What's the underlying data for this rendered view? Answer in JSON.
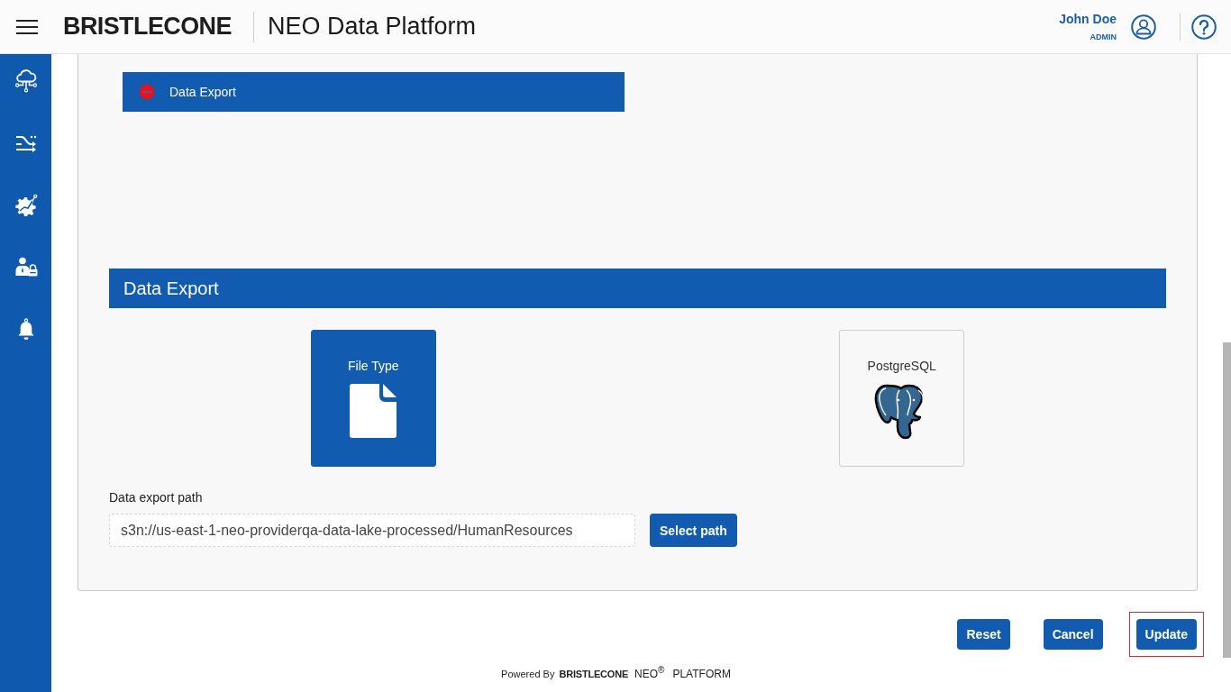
{
  "header": {
    "brand": "BRISTLECONE",
    "title": "NEO Data Platform",
    "user": {
      "name": "John Doe",
      "role": "ADMIN"
    }
  },
  "steps": [
    {
      "label": "Data Export",
      "selected": true
    }
  ],
  "section": {
    "title": "Data Export",
    "targets": [
      {
        "label": "File Type",
        "kind": "file",
        "selected": true
      },
      {
        "label": "PostgreSQL",
        "kind": "postgresql",
        "selected": false
      }
    ],
    "path": {
      "label": "Data export path",
      "value": "s3n://us-east-1-neo-providerqa-data-lake-processed/HumanResources",
      "button": "Select path"
    }
  },
  "actions": [
    {
      "label": "Reset",
      "highlighted": false
    },
    {
      "label": "Cancel",
      "highlighted": false
    },
    {
      "label": "Update",
      "highlighted": true
    }
  ],
  "footer": {
    "powered_by": "Powered By",
    "brand": "BRISTLECONE",
    "product": "NEO$^{®}$",
    "platform": "PLATFORM"
  }
}
